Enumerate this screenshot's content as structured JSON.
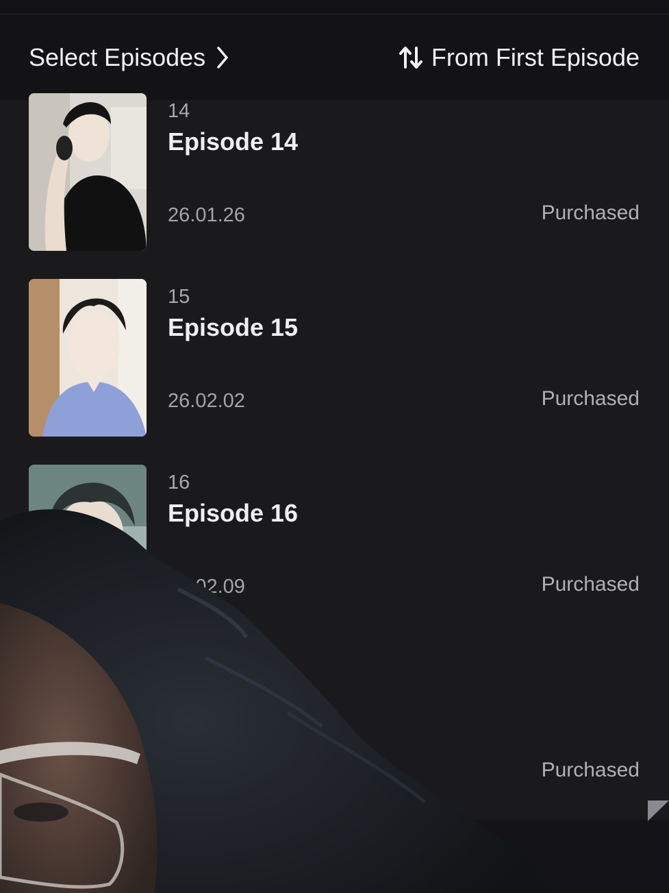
{
  "header": {
    "select_label": "Select Episodes",
    "sort_label": "From First Episode",
    "select_icon": "chevron-right-icon",
    "sort_icon": "sort-arrows-icon"
  },
  "episodes": [
    {
      "number": "14",
      "title": "Episode 14",
      "date": "26.01.26",
      "status": "Purchased"
    },
    {
      "number": "15",
      "title": "Episode 15",
      "date": "26.02.02",
      "status": "Purchased"
    },
    {
      "number": "16",
      "title": "Episode 16",
      "date": "26.02.09",
      "status": "Purchased"
    },
    {
      "number": "",
      "title": "",
      "date": "",
      "status": "Purchased"
    }
  ],
  "colors": {
    "background": "#1a1a1d",
    "header": "#131316",
    "text_primary": "#f0f0f2",
    "text_secondary": "#a8a8ae"
  }
}
